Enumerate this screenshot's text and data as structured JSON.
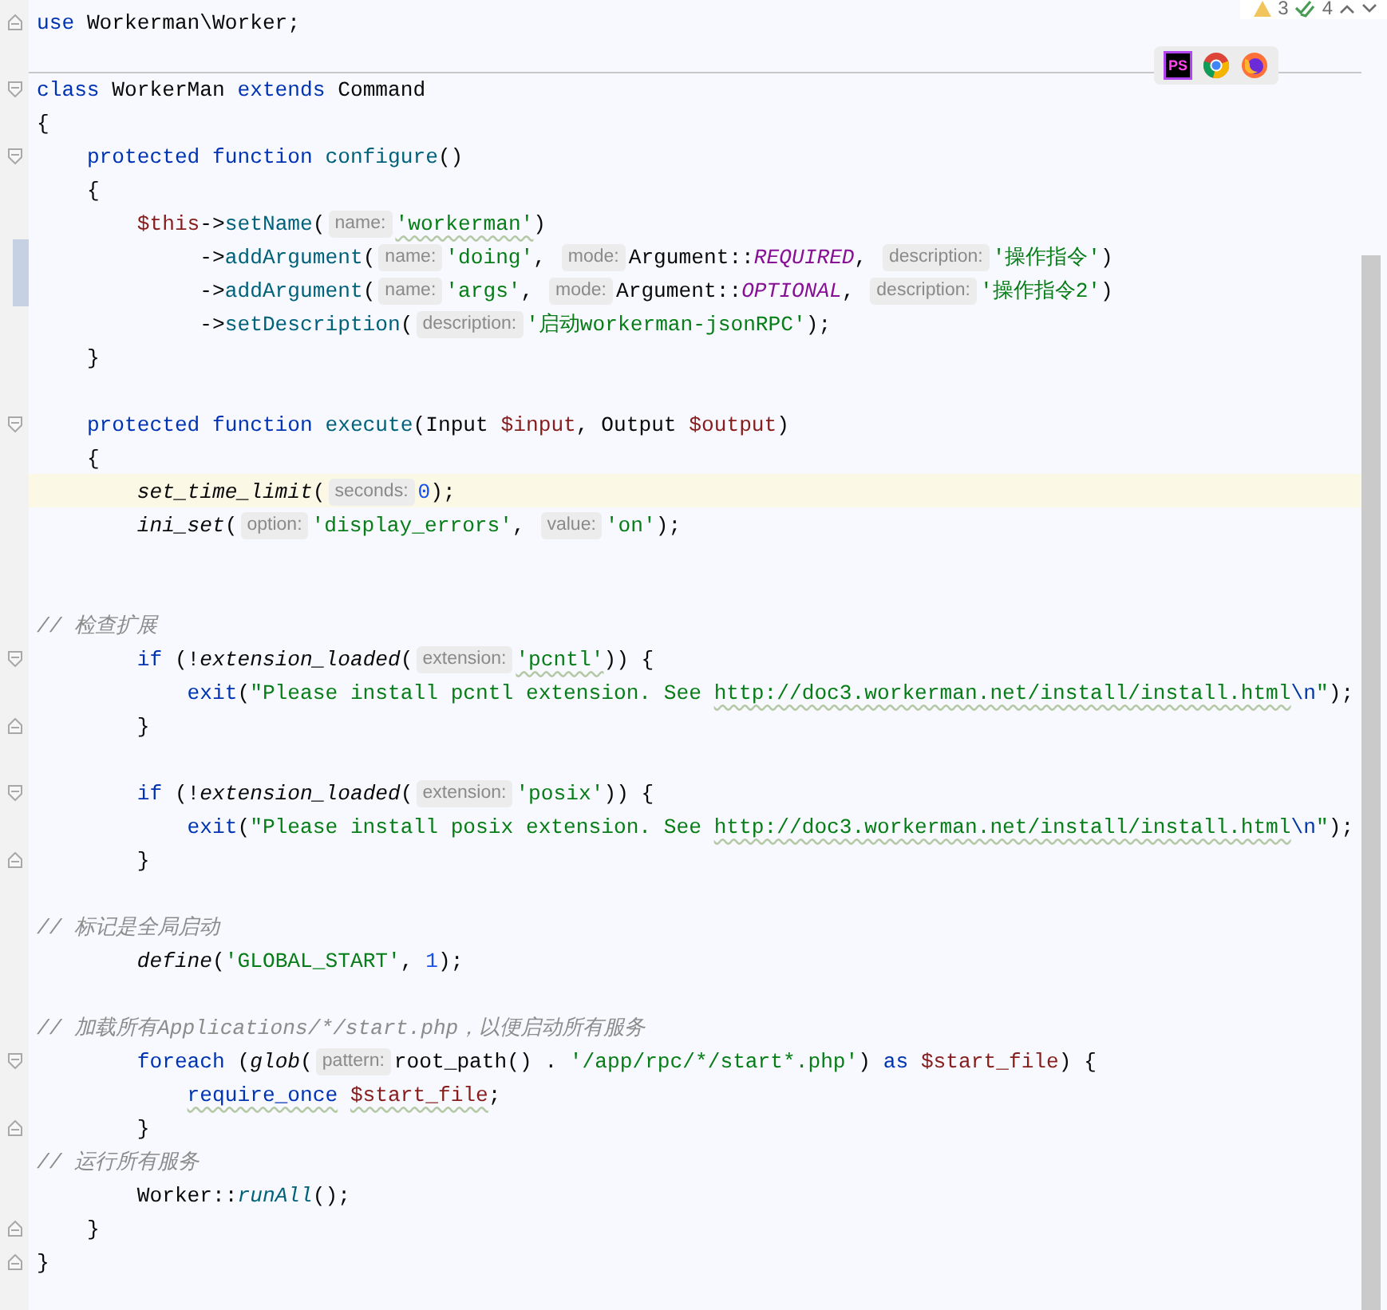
{
  "inspection_widget": {
    "warnings": "3",
    "checks": "4"
  },
  "browser_toolbar": {
    "ps_label": "PS",
    "browsers": [
      {
        "kind": "round"
      },
      {
        "kind": "fox"
      }
    ]
  },
  "lines": [
    {
      "gutter": {
        "kind": "fold-end"
      },
      "changed": false,
      "current": false,
      "separator_above": false,
      "tokens": [
        {
          "kind": "kw",
          "text": "use"
        },
        {
          "kind": "plain",
          "text": " Workerman\\Worker;"
        }
      ]
    },
    {
      "changed": false,
      "current": false,
      "separator_above": false
    },
    {
      "gutter": {
        "kind": "fold-start"
      },
      "changed": false,
      "current": false,
      "separator_above": true,
      "tokens": [
        {
          "kind": "kw",
          "text": "class"
        },
        {
          "kind": "plain",
          "text": " WorkerMan "
        },
        {
          "kind": "kw",
          "text": "extends"
        },
        {
          "kind": "plain",
          "text": " Command"
        }
      ]
    },
    {
      "changed": false,
      "current": false,
      "separator_above": false,
      "tokens": [
        {
          "kind": "plain",
          "text": "{"
        }
      ]
    },
    {
      "gutter": {
        "kind": "fold-start"
      },
      "changed": false,
      "current": false,
      "separator_above": false,
      "tokens": [
        {
          "kind": "kw",
          "text": "    protected function "
        },
        {
          "kind": "fn",
          "text": "configure"
        },
        {
          "kind": "plain",
          "text": "()"
        }
      ]
    },
    {
      "changed": false,
      "current": false,
      "separator_above": false,
      "tokens": [
        {
          "kind": "plain",
          "text": "    {"
        }
      ]
    },
    {
      "changed": false,
      "current": false,
      "separator_above": false,
      "tokens": [
        {
          "kind": "var",
          "text": "        $this"
        },
        {
          "kind": "plain",
          "text": "->"
        },
        {
          "kind": "call",
          "text": "setName"
        },
        {
          "kind": "plain",
          "text": "("
        },
        {
          "kind": "hint",
          "text": "name:"
        },
        {
          "kind": "str",
          "text": "'workerman'",
          "squiggle": true
        },
        {
          "kind": "plain",
          "text": ")"
        }
      ]
    },
    {
      "changed": true,
      "current": false,
      "separator_above": false,
      "tokens": [
        {
          "kind": "plain",
          "text": "             ->"
        },
        {
          "kind": "call",
          "text": "addArgument"
        },
        {
          "kind": "plain",
          "text": "("
        },
        {
          "kind": "hint",
          "text": "name:"
        },
        {
          "kind": "str",
          "text": "'doing'"
        },
        {
          "kind": "plain",
          "text": ", "
        },
        {
          "kind": "hint",
          "text": "mode:"
        },
        {
          "kind": "plain",
          "text": "Argument::"
        },
        {
          "kind": "const",
          "text": "REQUIRED"
        },
        {
          "kind": "plain",
          "text": ", "
        },
        {
          "kind": "hint",
          "text": "description:"
        },
        {
          "kind": "str",
          "text": "'操作指令'"
        },
        {
          "kind": "plain",
          "text": ")"
        }
      ]
    },
    {
      "changed": true,
      "current": false,
      "separator_above": false,
      "tokens": [
        {
          "kind": "plain",
          "text": "             ->"
        },
        {
          "kind": "call",
          "text": "addArgument"
        },
        {
          "kind": "plain",
          "text": "("
        },
        {
          "kind": "hint",
          "text": "name:"
        },
        {
          "kind": "str",
          "text": "'args'"
        },
        {
          "kind": "plain",
          "text": ", "
        },
        {
          "kind": "hint",
          "text": "mode:"
        },
        {
          "kind": "plain",
          "text": "Argument::"
        },
        {
          "kind": "const",
          "text": "OPTIONAL"
        },
        {
          "kind": "plain",
          "text": ", "
        },
        {
          "kind": "hint",
          "text": "description:"
        },
        {
          "kind": "str",
          "text": "'操作指令2'"
        },
        {
          "kind": "plain",
          "text": ")"
        }
      ]
    },
    {
      "changed": false,
      "current": false,
      "separator_above": false,
      "tokens": [
        {
          "kind": "plain",
          "text": "             ->"
        },
        {
          "kind": "call",
          "text": "setDescription"
        },
        {
          "kind": "plain",
          "text": "("
        },
        {
          "kind": "hint",
          "text": "description:"
        },
        {
          "kind": "str",
          "text": "'启动workerman-jsonRPC'"
        },
        {
          "kind": "plain",
          "text": ");"
        }
      ]
    },
    {
      "changed": false,
      "current": false,
      "separator_above": false,
      "tokens": [
        {
          "kind": "plain",
          "text": "    }"
        }
      ]
    },
    {
      "changed": false,
      "current": false,
      "separator_above": false
    },
    {
      "gutter": {
        "kind": "fold-start"
      },
      "changed": false,
      "current": false,
      "separator_above": false,
      "tokens": [
        {
          "kind": "kw",
          "text": "    protected function "
        },
        {
          "kind": "fn",
          "text": "execute"
        },
        {
          "kind": "plain",
          "text": "(Input "
        },
        {
          "kind": "var",
          "text": "$input"
        },
        {
          "kind": "plain",
          "text": ", Output "
        },
        {
          "kind": "var",
          "text": "$output"
        },
        {
          "kind": "plain",
          "text": ")"
        }
      ]
    },
    {
      "changed": false,
      "current": false,
      "separator_above": false,
      "tokens": [
        {
          "kind": "plain",
          "text": "    {"
        }
      ]
    },
    {
      "changed": false,
      "current": true,
      "separator_above": false,
      "tokens": [
        {
          "kind": "ifn",
          "text": "        set_time_limit"
        },
        {
          "kind": "plain",
          "text": "("
        },
        {
          "kind": "hint",
          "text": "seconds:"
        },
        {
          "kind": "num",
          "text": "0"
        },
        {
          "kind": "plain",
          "text": ");"
        }
      ]
    },
    {
      "changed": false,
      "current": false,
      "separator_above": false,
      "tokens": [
        {
          "kind": "ifn",
          "text": "        ini_set"
        },
        {
          "kind": "plain",
          "text": "("
        },
        {
          "kind": "hint",
          "text": "option:"
        },
        {
          "kind": "str",
          "text": "'display_errors'"
        },
        {
          "kind": "plain",
          "text": ", "
        },
        {
          "kind": "hint",
          "text": "value:"
        },
        {
          "kind": "str",
          "text": "'on'"
        },
        {
          "kind": "plain",
          "text": ");"
        }
      ]
    },
    {
      "changed": false,
      "current": false,
      "separator_above": false
    },
    {
      "changed": false,
      "current": false,
      "separator_above": false
    },
    {
      "changed": false,
      "current": false,
      "separator_above": false,
      "tokens": [
        {
          "kind": "cmt",
          "text": "// 检查扩展"
        }
      ]
    },
    {
      "gutter": {
        "kind": "fold-start"
      },
      "changed": false,
      "current": false,
      "separator_above": false,
      "tokens": [
        {
          "kind": "kw",
          "text": "        if"
        },
        {
          "kind": "plain",
          "text": " (!"
        },
        {
          "kind": "ifn",
          "text": "extension_loaded"
        },
        {
          "kind": "plain",
          "text": "("
        },
        {
          "kind": "hint",
          "text": "extension:"
        },
        {
          "kind": "str",
          "text": "'pcntl'",
          "squiggle": true
        },
        {
          "kind": "plain",
          "text": ")) {"
        }
      ]
    },
    {
      "changed": false,
      "current": false,
      "separator_above": false,
      "tokens": [
        {
          "kind": "kw",
          "text": "            exit"
        },
        {
          "kind": "plain",
          "text": "("
        },
        {
          "kind": "str",
          "text": "\"Please install pcntl extension. See "
        },
        {
          "kind": "str",
          "text": "http://doc3.workerman.net/install/install.html",
          "squiggle": true
        },
        {
          "kind": "esc",
          "text": "\\n"
        },
        {
          "kind": "str",
          "text": "\""
        },
        {
          "kind": "plain",
          "text": ");"
        }
      ]
    },
    {
      "gutter": {
        "kind": "fold-end"
      },
      "changed": false,
      "current": false,
      "separator_above": false,
      "tokens": [
        {
          "kind": "plain",
          "text": "        }"
        }
      ]
    },
    {
      "changed": false,
      "current": false,
      "separator_above": false
    },
    {
      "gutter": {
        "kind": "fold-start"
      },
      "changed": false,
      "current": false,
      "separator_above": false,
      "tokens": [
        {
          "kind": "kw",
          "text": "        if"
        },
        {
          "kind": "plain",
          "text": " (!"
        },
        {
          "kind": "ifn",
          "text": "extension_loaded"
        },
        {
          "kind": "plain",
          "text": "("
        },
        {
          "kind": "hint",
          "text": "extension:"
        },
        {
          "kind": "str",
          "text": "'posix'"
        },
        {
          "kind": "plain",
          "text": ")) {"
        }
      ]
    },
    {
      "changed": false,
      "current": false,
      "separator_above": false,
      "tokens": [
        {
          "kind": "kw",
          "text": "            exit"
        },
        {
          "kind": "plain",
          "text": "("
        },
        {
          "kind": "str",
          "text": "\"Please install posix extension. See "
        },
        {
          "kind": "str",
          "text": "http://doc3.workerman.net/install/install.html",
          "squiggle": true
        },
        {
          "kind": "esc",
          "text": "\\n"
        },
        {
          "kind": "str",
          "text": "\""
        },
        {
          "kind": "plain",
          "text": ");"
        }
      ]
    },
    {
      "gutter": {
        "kind": "fold-end"
      },
      "changed": false,
      "current": false,
      "separator_above": false,
      "tokens": [
        {
          "kind": "plain",
          "text": "        }"
        }
      ]
    },
    {
      "changed": false,
      "current": false,
      "separator_above": false
    },
    {
      "changed": false,
      "current": false,
      "separator_above": false,
      "tokens": [
        {
          "kind": "cmt",
          "text": "// 标记是全局启动"
        }
      ]
    },
    {
      "changed": false,
      "current": false,
      "separator_above": false,
      "tokens": [
        {
          "kind": "ifn",
          "text": "        define"
        },
        {
          "kind": "plain",
          "text": "("
        },
        {
          "kind": "str",
          "text": "'GLOBAL_START'"
        },
        {
          "kind": "plain",
          "text": ", "
        },
        {
          "kind": "num",
          "text": "1"
        },
        {
          "kind": "plain",
          "text": ");"
        }
      ]
    },
    {
      "changed": false,
      "current": false,
      "separator_above": false
    },
    {
      "changed": false,
      "current": false,
      "separator_above": false,
      "tokens": [
        {
          "kind": "cmt",
          "text": "// 加载所有Applications/*/start.php，以便启动所有服务"
        }
      ]
    },
    {
      "gutter": {
        "kind": "fold-start"
      },
      "changed": false,
      "current": false,
      "separator_above": false,
      "tokens": [
        {
          "kind": "kw",
          "text": "        foreach"
        },
        {
          "kind": "plain",
          "text": " ("
        },
        {
          "kind": "ifn",
          "text": "glob"
        },
        {
          "kind": "plain",
          "text": "("
        },
        {
          "kind": "hint",
          "text": "pattern:"
        },
        {
          "kind": "plain",
          "text": "root_path() . "
        },
        {
          "kind": "str",
          "text": "'/app/rpc/*/start*.php'"
        },
        {
          "kind": "plain",
          "text": ") "
        },
        {
          "kind": "kw",
          "text": "as"
        },
        {
          "kind": "var",
          "text": " $start_file"
        },
        {
          "kind": "plain",
          "text": ") {"
        }
      ]
    },
    {
      "changed": false,
      "current": false,
      "separator_above": false,
      "tokens": [
        {
          "kind": "kw",
          "text": "            require_once",
          "squiggle": true
        },
        {
          "kind": "var",
          "text": " $start_file",
          "squiggle": true
        },
        {
          "kind": "plain",
          "text": ";"
        }
      ]
    },
    {
      "gutter": {
        "kind": "fold-end"
      },
      "changed": false,
      "current": false,
      "separator_above": false,
      "tokens": [
        {
          "kind": "plain",
          "text": "        }"
        }
      ]
    },
    {
      "changed": false,
      "current": false,
      "separator_above": false,
      "tokens": [
        {
          "kind": "cmt",
          "text": "// 运行所有服务"
        }
      ]
    },
    {
      "changed": false,
      "current": false,
      "separator_above": false,
      "tokens": [
        {
          "kind": "plain",
          "text": "        Worker::"
        },
        {
          "kind": "icall",
          "text": "runAll"
        },
        {
          "kind": "plain",
          "text": "();"
        }
      ]
    },
    {
      "gutter": {
        "kind": "fold-end"
      },
      "changed": false,
      "current": false,
      "separator_above": false,
      "tokens": [
        {
          "kind": "plain",
          "text": "    }"
        }
      ]
    },
    {
      "gutter": {
        "kind": "fold-end"
      },
      "changed": false,
      "current": false,
      "separator_above": false,
      "tokens": [
        {
          "kind": "plain",
          "text": "}"
        }
      ]
    }
  ]
}
